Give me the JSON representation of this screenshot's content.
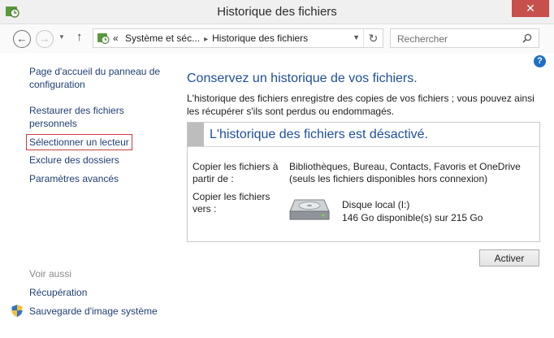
{
  "window": {
    "title": "Historique des fichiers",
    "close_label": "✕"
  },
  "address": {
    "overflow": "«",
    "crumbs": [
      "Système et séc...",
      "Historique des fichiers"
    ],
    "separator": "▸",
    "search_placeholder": "Rechercher"
  },
  "sidebar": {
    "items": [
      {
        "label": "Page d'accueil du panneau de configuration"
      },
      {
        "label": "Restaurer des fichiers personnels"
      },
      {
        "label": "Sélectionner un lecteur"
      },
      {
        "label": "Exclure des dossiers"
      },
      {
        "label": "Paramètres avancés"
      }
    ],
    "see_also": {
      "heading": "Voir aussi",
      "links": [
        "Récupération",
        "Sauvegarde d'image système"
      ]
    }
  },
  "main": {
    "heading": "Conservez un historique de vos fichiers.",
    "description": "L'historique des fichiers enregistre des copies de vos fichiers ; vous pouvez ainsi les récupérer s'ils sont perdus ou endommagés.",
    "status": {
      "title": "L'historique des fichiers est désactivé.",
      "copy_from_label": "Copier les fichiers à partir de :",
      "copy_from_value": "Bibliothèques, Bureau, Contacts, Favoris et OneDrive (seuls les fichiers disponibles hors connexion)",
      "copy_to_label": "Copier les fichiers vers :",
      "drive_name": "Disque local (I:)",
      "drive_space": "146 Go disponible(s) sur 215 Go"
    },
    "activate_label": "Activer"
  },
  "colors": {
    "link": "#1e3f74",
    "heading": "#1c4f9c",
    "close": "#c7504a",
    "highlight": "#cc3a3a"
  },
  "icons": {
    "app": "file-history-icon",
    "back": "back-arrow-icon",
    "forward": "forward-arrow-icon",
    "up": "up-arrow-icon",
    "refresh": "refresh-icon",
    "search": "search-icon",
    "help": "help-icon",
    "shield": "shield-icon",
    "drive": "hard-drive-icon"
  }
}
